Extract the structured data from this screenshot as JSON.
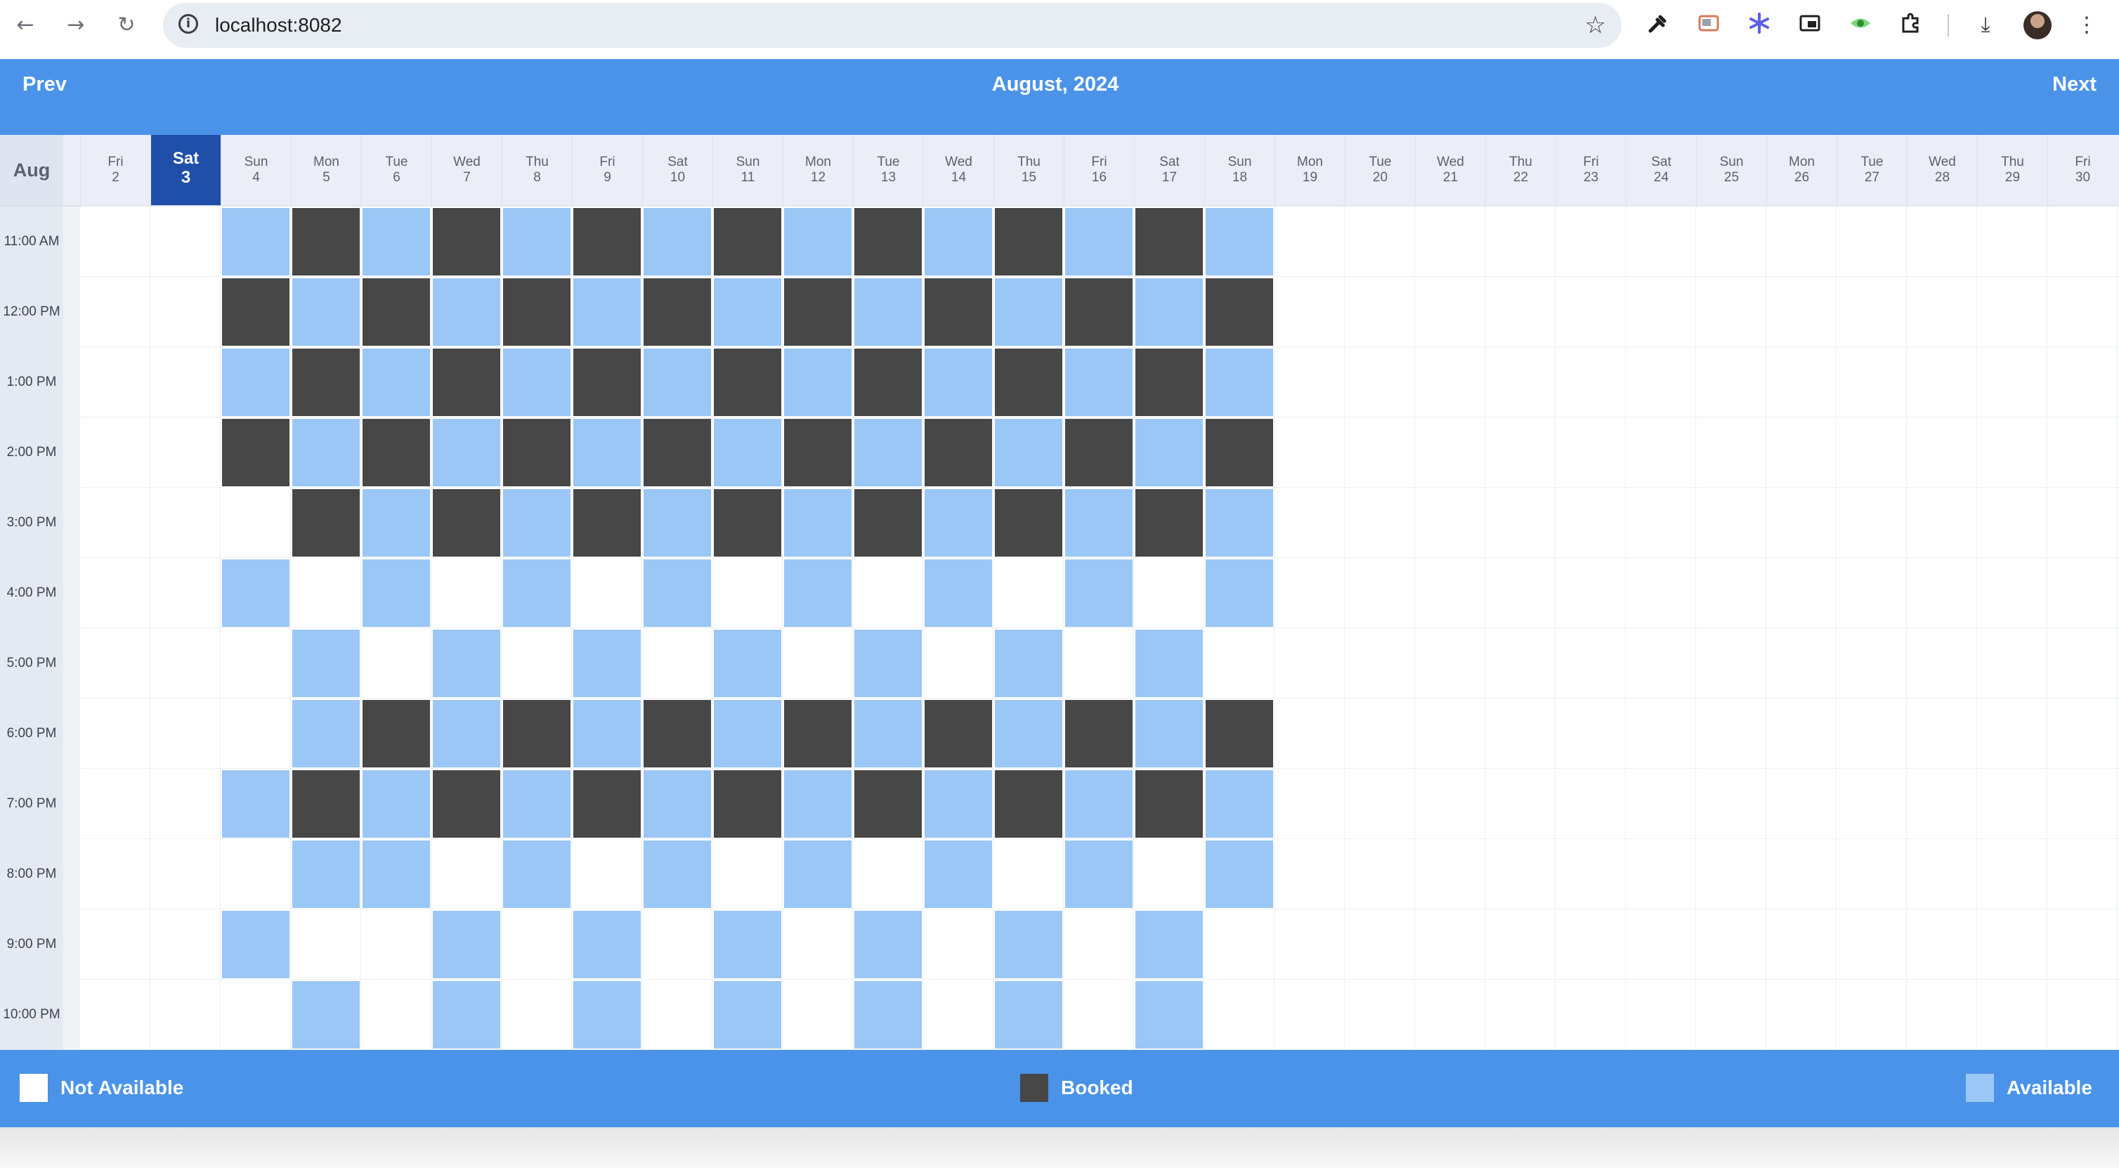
{
  "browser": {
    "url": "localhost:8082",
    "back_icon": "←",
    "forward_icon": "→",
    "reload_icon": "↻",
    "info_icon": "i",
    "star_icon": "☆",
    "menu_icon": "⋮",
    "download_icon": "⤓"
  },
  "header": {
    "prev_label": "Prev",
    "title": "August, 2024",
    "next_label": "Next"
  },
  "calendar": {
    "month_label": "Aug",
    "days": [
      {
        "dow": "Fri",
        "date": "2"
      },
      {
        "dow": "Sat",
        "date": "3",
        "today": true
      },
      {
        "dow": "Sun",
        "date": "4"
      },
      {
        "dow": "Mon",
        "date": "5"
      },
      {
        "dow": "Tue",
        "date": "6"
      },
      {
        "dow": "Wed",
        "date": "7"
      },
      {
        "dow": "Thu",
        "date": "8"
      },
      {
        "dow": "Fri",
        "date": "9"
      },
      {
        "dow": "Sat",
        "date": "10"
      },
      {
        "dow": "Sun",
        "date": "11"
      },
      {
        "dow": "Mon",
        "date": "12"
      },
      {
        "dow": "Tue",
        "date": "13"
      },
      {
        "dow": "Wed",
        "date": "14"
      },
      {
        "dow": "Thu",
        "date": "15"
      },
      {
        "dow": "Fri",
        "date": "16"
      },
      {
        "dow": "Sat",
        "date": "17"
      },
      {
        "dow": "Sun",
        "date": "18"
      },
      {
        "dow": "Mon",
        "date": "19"
      },
      {
        "dow": "Tue",
        "date": "20"
      },
      {
        "dow": "Wed",
        "date": "21"
      },
      {
        "dow": "Thu",
        "date": "22"
      },
      {
        "dow": "Fri",
        "date": "23"
      },
      {
        "dow": "Sat",
        "date": "24"
      },
      {
        "dow": "Sun",
        "date": "25"
      },
      {
        "dow": "Mon",
        "date": "26"
      },
      {
        "dow": "Tue",
        "date": "27"
      },
      {
        "dow": "Wed",
        "date": "28"
      },
      {
        "dow": "Thu",
        "date": "29"
      },
      {
        "dow": "Fri",
        "date": "30"
      }
    ],
    "times": [
      "11:00 AM",
      "12:00 PM",
      "1:00 PM",
      "2:00 PM",
      "3:00 PM",
      "4:00 PM",
      "5:00 PM",
      "6:00 PM",
      "7:00 PM",
      "8:00 PM",
      "9:00 PM",
      "10:00 PM"
    ],
    "slot_legend": {
      "N": "Not Available",
      "B": "Booked",
      "A": "Available"
    },
    "slots": [
      "NNABABABABABABABANNNNNNNNNNNN",
      "NNBABABABABABABABNNNNNNNNNNNN",
      "NNABABABABABABABANNNNNNNNNNNN",
      "NNBABABABABABABABNNNNNNNNNNNN",
      "NNNBABABABABABABANNNNNNNNNNNN",
      "NNANANANANANANANANNNNNNNNNNNN",
      "NNNANANANANANANANNNNNNNNNNNNN",
      "NNNABABABABABABABNNNNNNNNNNNN",
      "NNABABABABABABABANNNNNNNNNNNN",
      "NNNAANANANANANANANNNNNNNNNNNN",
      "NNANNANANANANANANNNNNNNNNNNNN",
      "NNNANANANANANANANNNNNNNNNNNNN"
    ]
  },
  "legend": {
    "not_available": "Not Available",
    "booked": "Booked",
    "available": "Available"
  },
  "colors": {
    "primary": "#4a93e8",
    "today": "#1f4fa8",
    "available": "#9ac7f5",
    "booked": "#474747",
    "not_available": "#ffffff"
  }
}
